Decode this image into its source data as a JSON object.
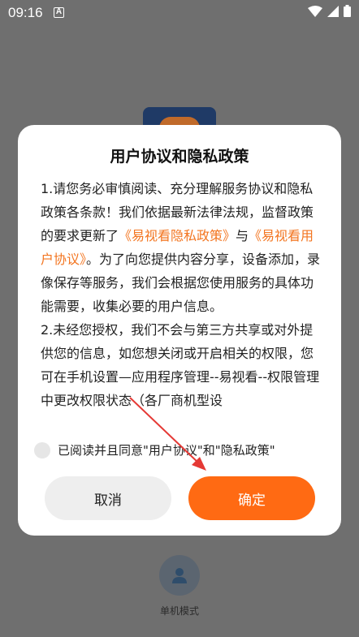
{
  "status": {
    "time": "09:16",
    "notif_letter": "A"
  },
  "dialog": {
    "title": "用户协议和隐私政策",
    "p1_a": "1.请您务必审慎阅读、充分理解服务协议和隐私政策各条款！我们依据最新法律法规，监督政策的要求更新了",
    "p1_link1": "《易视看隐私政策》",
    "p1_b": "与",
    "p1_link2": "《易视看用户协议》",
    "p1_c": "。为了向您提供内容分享，设备添加，录像保存等服务，我们会根据您使用服务的具体功能需要，收集必要的用户信息。",
    "p2": "2.未经您授权，我们不会与第三方共享或对外提供您的信息，如您想关闭或开启相关的权限，您可在手机设置—应用程序管理--易视看--权限管理中更改权限状态（各厂商机型设",
    "consent_label": "已阅读并且同意\"用户协议\"和\"隐私政策\"",
    "cancel_label": "取消",
    "confirm_label": "确定"
  },
  "background": {
    "offline_label": "单机模式"
  },
  "colors": {
    "accent": "#ff6a13",
    "link": "#f37520",
    "annotation_arrow": "#e53935"
  }
}
